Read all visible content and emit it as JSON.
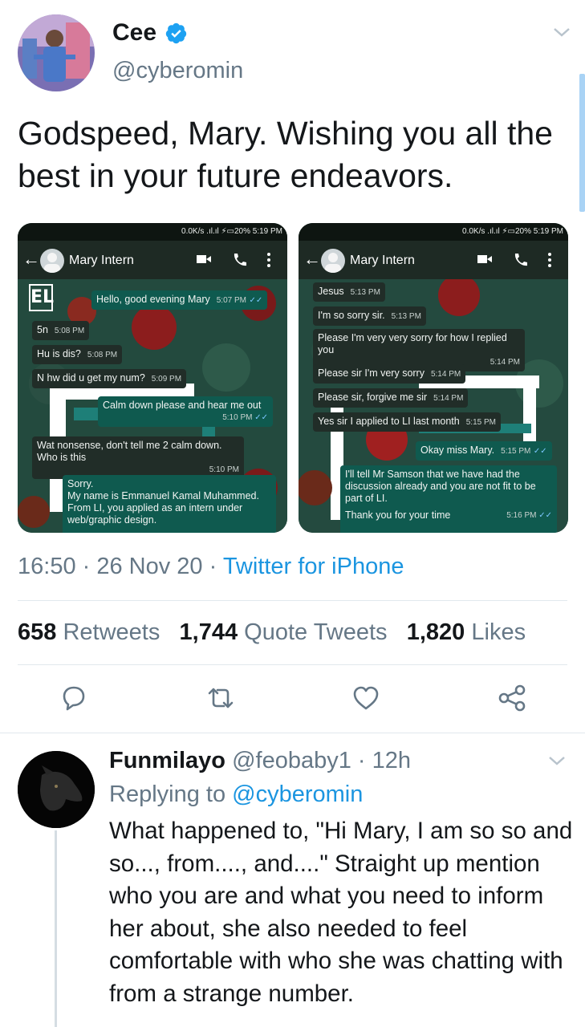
{
  "tweet": {
    "display_name": "Cee",
    "handle": "@cyberomin",
    "text": "Godspeed, Mary. Wishing you all the best in your future endeavors.",
    "time": "16:50",
    "date": "26 Nov 20",
    "client": "Twitter for iPhone",
    "stats": {
      "retweets_count": "658",
      "retweets_label": "Retweets",
      "quotes_count": "1,744",
      "quotes_label": "Quote Tweets",
      "likes_count": "1,820",
      "likes_label": "Likes"
    }
  },
  "screenshots": {
    "left": {
      "status": "0.0K/s .ıl.ıl ⚡▭20% 5:19 PM",
      "chat_title": "Mary Intern",
      "messages": [
        {
          "text": "Hello, good evening Mary",
          "time": "5:07 PM"
        },
        {
          "text": "5n",
          "time": "5:08 PM"
        },
        {
          "text": "Hu is dis?",
          "time": "5:08 PM"
        },
        {
          "text": "N hw did u get my num?",
          "time": "5:09 PM"
        },
        {
          "text": "Calm down please and hear me out",
          "time": "5:10 PM"
        },
        {
          "text": "Wat nonsense, don't tell me 2 calm down. Who is this",
          "time": "5:10 PM"
        },
        {
          "text": "Sorry.",
          "text2": "My name is Emmanuel Kamal Muhammed.",
          "text3": "From LI, you applied as an intern under",
          "text4": "web/graphic design."
        }
      ]
    },
    "right": {
      "status": "0.0K/s .ıl.ıl ⚡▭20% 5:19 PM",
      "chat_title": "Mary Intern",
      "messages": [
        {
          "text": "Jesus",
          "time": "5:13 PM"
        },
        {
          "text": "I'm so sorry sir.",
          "time": "5:13 PM"
        },
        {
          "text": "Please I'm very very sorry for how I replied you",
          "time": "5:14 PM"
        },
        {
          "text": "Please sir I'm very sorry",
          "time": "5:14 PM"
        },
        {
          "text": "Please sir, forgive me sir",
          "time": "5:14 PM"
        },
        {
          "text": "Yes sir I applied to LI last month",
          "time": "5:15 PM"
        },
        {
          "text": "Okay miss Mary.",
          "time": "5:15 PM"
        },
        {
          "text": "I'll tell Mr Samson that we have had the discussion already and you are not fit to be part of LI."
        },
        {
          "text": "Thank you for your time",
          "time": "5:16 PM"
        }
      ]
    }
  },
  "reply": {
    "display_name": "Funmilayo",
    "handle": "@feobaby1",
    "age": "· 12h",
    "replying_label": "Replying to",
    "replying_to": "@cyberomin",
    "text": "What happened to, \"Hi Mary, I am so so and so..., from...., and....\" Straight up mention who you are and what you need to inform her about, she also needed to feel comfortable with who she was chatting with from a strange number."
  },
  "icons": {
    "verified": "verified-badge-icon",
    "reply": "reply-icon",
    "retweet": "retweet-icon",
    "like": "heart-icon",
    "share": "share-icon",
    "more": "chevron-down-icon"
  },
  "colors": {
    "link_blue": "#1b95e0",
    "secondary_text": "#657786",
    "primary_text": "#14171a",
    "divider": "#e1e8ed"
  }
}
